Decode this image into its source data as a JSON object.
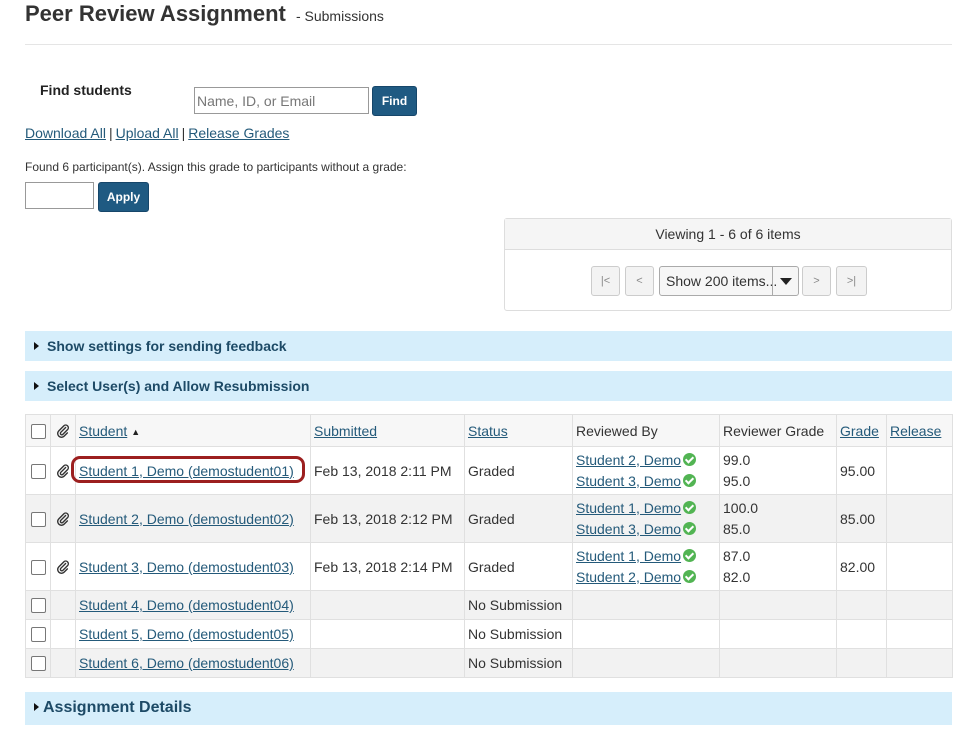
{
  "page": {
    "title": "Peer Review Assignment",
    "subtitle": "- Submissions"
  },
  "find": {
    "label": "Find students",
    "placeholder": "Name, ID, or Email",
    "button_label": "Find"
  },
  "links": {
    "download_all": "Download All",
    "upload_all": "Upload All",
    "release_grades": "Release Grades",
    "separator": "|"
  },
  "bulk_grade": {
    "text": "Found 6 participant(s). Assign this grade to participants without a grade:",
    "input_value": "",
    "button_label": "Apply"
  },
  "pager": {
    "viewing": "Viewing 1 - 6 of 6 items",
    "first": "|<",
    "prev": "<",
    "page_size": "Show 200 items...",
    "next": ">",
    "last": ">|"
  },
  "sections": {
    "feedback_settings": "Show settings for sending feedback",
    "resubmission": "Select User(s) and Allow Resubmission",
    "assignment_details": "Assignment Details"
  },
  "table": {
    "headers": {
      "student": "Student",
      "submitted": "Submitted",
      "status": "Status",
      "reviewed_by": "Reviewed By",
      "reviewer_grade": "Reviewer Grade",
      "grade": "Grade",
      "release": "Release"
    },
    "rows": [
      {
        "student": "Student 1, Demo (demostudent01)",
        "submitted": "Feb 13, 2018 2:11 PM",
        "status": "Graded",
        "reviewers": [
          "Student 2, Demo",
          "Student 3, Demo"
        ],
        "reviewer_grades": [
          "99.0",
          "95.0"
        ],
        "grade": "95.00",
        "release": ""
      },
      {
        "student": "Student 2, Demo (demostudent02)",
        "submitted": "Feb 13, 2018 2:12 PM",
        "status": "Graded",
        "reviewers": [
          "Student 1, Demo",
          "Student 3, Demo"
        ],
        "reviewer_grades": [
          "100.0",
          "85.0"
        ],
        "grade": "85.00",
        "release": ""
      },
      {
        "student": "Student 3, Demo (demostudent03)",
        "submitted": "Feb 13, 2018 2:14 PM",
        "status": "Graded",
        "reviewers": [
          "Student 1, Demo",
          "Student 2, Demo"
        ],
        "reviewer_grades": [
          "87.0",
          "82.0"
        ],
        "grade": "82.00",
        "release": ""
      },
      {
        "student": "Student 4, Demo (demostudent04)",
        "submitted": "",
        "status": "No Submission",
        "reviewers": [],
        "reviewer_grades": [],
        "grade": "",
        "release": ""
      },
      {
        "student": "Student 5, Demo (demostudent05)",
        "submitted": "",
        "status": "No Submission",
        "reviewers": [],
        "reviewer_grades": [],
        "grade": "",
        "release": ""
      },
      {
        "student": "Student 6, Demo (demostudent06)",
        "submitted": "",
        "status": "No Submission",
        "reviewers": [],
        "reviewer_grades": [],
        "grade": "",
        "release": ""
      }
    ]
  },
  "icons": {
    "attachment": "paperclip-icon",
    "reviewed": "check-circle-icon",
    "sort": "sort-ascending-icon",
    "expand": "expand-triangle-icon"
  },
  "colors": {
    "primary_button": "#1f5a82",
    "link": "#245a7a",
    "section_band": "#d6eefb",
    "check_ok": "#52b453",
    "highlight_ring": "#9c1f1f"
  }
}
